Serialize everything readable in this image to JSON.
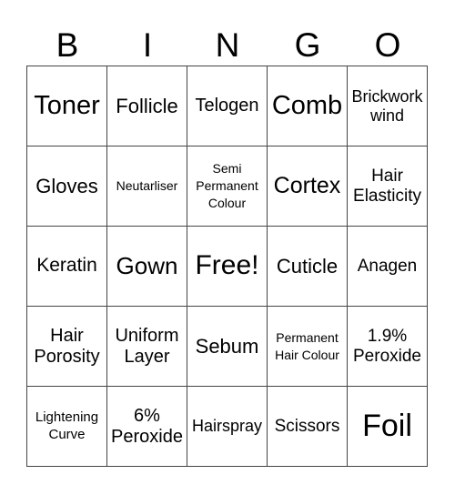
{
  "header": [
    "B",
    "I",
    "N",
    "G",
    "O"
  ],
  "cells": [
    [
      "Toner",
      "Follicle",
      "Telogen",
      "Comb",
      "Brickwork wind"
    ],
    [
      "Gloves",
      "Neutarliser",
      "Semi Permanent Colour",
      "Cortex",
      "Hair Elasticity"
    ],
    [
      "Keratin",
      "Gown",
      "Free!",
      "Cuticle",
      "Anagen"
    ],
    [
      "Hair Porosity",
      "Uniform Layer",
      "Sebum",
      "Permanent Hair Colour",
      "1.9% Peroxide"
    ],
    [
      "Lightening Curve",
      "6% Peroxide",
      "Hairspray",
      "Scissors",
      "Foil"
    ]
  ]
}
